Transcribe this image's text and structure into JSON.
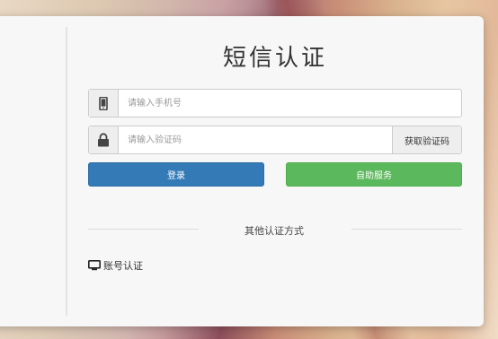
{
  "page": {
    "title": "短信认证"
  },
  "form": {
    "phone_placeholder": "请输入手机号",
    "phone_icon": "mobile-phone-icon",
    "code_placeholder": "请输入验证码",
    "code_icon": "lock-icon",
    "get_code_label": "获取验证码"
  },
  "actions": {
    "login_label": "登录",
    "self_service_label": "自助服务",
    "login_color": "#337ab7",
    "self_service_color": "#5cb85c"
  },
  "other_methods": {
    "heading": "其他认证方式",
    "account_label": "账号认证",
    "account_icon": "monitor-icon"
  }
}
